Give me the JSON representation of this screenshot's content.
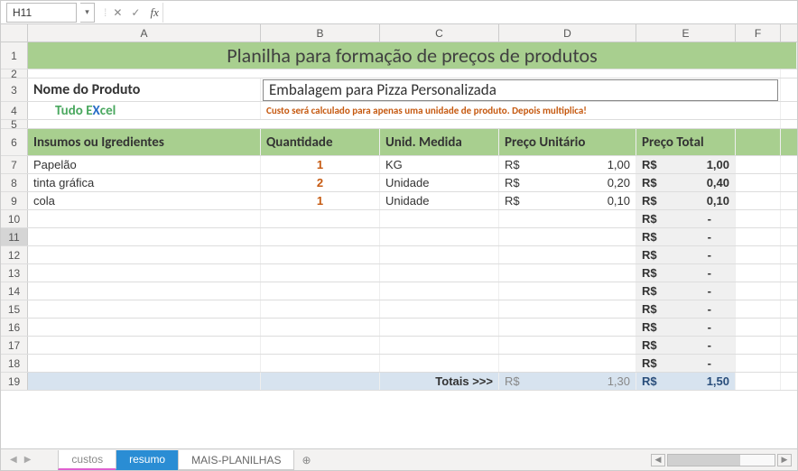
{
  "name_box": "H11",
  "fx_value": "",
  "columns": [
    "A",
    "B",
    "C",
    "D",
    "E",
    "F"
  ],
  "title": "Planilha para formação de preços de produtos",
  "product_label": "Nome do Produto",
  "brand_parts": {
    "tudo": "Tudo E",
    "x": "X",
    "cel": "cel"
  },
  "product_name": "Embalagem para Pizza Personalizada",
  "note": "Custo será calculado para apenas uma unidade de produto. Depois multiplica!",
  "headers": {
    "a": "Insumos ou Igredientes",
    "b": "Quantidade",
    "c": "Unid. Medida",
    "d": "Preço Unitário",
    "e": "Preço Total"
  },
  "rows": [
    {
      "name": "Papelão",
      "qty": "1",
      "unit": "KG",
      "price_cur": "R$",
      "price_val": "1,00",
      "total_cur": "R$",
      "total_val": "1,00"
    },
    {
      "name": "tinta gráfica",
      "qty": "2",
      "unit": "Unidade",
      "price_cur": "R$",
      "price_val": "0,20",
      "total_cur": "R$",
      "total_val": "0,40"
    },
    {
      "name": "cola",
      "qty": "1",
      "unit": "Unidade",
      "price_cur": "R$",
      "price_val": "0,10",
      "total_cur": "R$",
      "total_val": "0,10"
    },
    {
      "name": "",
      "qty": "",
      "unit": "",
      "price_cur": "",
      "price_val": "",
      "total_cur": "R$",
      "total_val": "-"
    },
    {
      "name": "",
      "qty": "",
      "unit": "",
      "price_cur": "",
      "price_val": "",
      "total_cur": "R$",
      "total_val": "-"
    },
    {
      "name": "",
      "qty": "",
      "unit": "",
      "price_cur": "",
      "price_val": "",
      "total_cur": "R$",
      "total_val": "-"
    },
    {
      "name": "",
      "qty": "",
      "unit": "",
      "price_cur": "",
      "price_val": "",
      "total_cur": "R$",
      "total_val": "-"
    },
    {
      "name": "",
      "qty": "",
      "unit": "",
      "price_cur": "",
      "price_val": "",
      "total_cur": "R$",
      "total_val": "-"
    },
    {
      "name": "",
      "qty": "",
      "unit": "",
      "price_cur": "",
      "price_val": "",
      "total_cur": "R$",
      "total_val": "-"
    },
    {
      "name": "",
      "qty": "",
      "unit": "",
      "price_cur": "",
      "price_val": "",
      "total_cur": "R$",
      "total_val": "-"
    },
    {
      "name": "",
      "qty": "",
      "unit": "",
      "price_cur": "",
      "price_val": "",
      "total_cur": "R$",
      "total_val": "-"
    },
    {
      "name": "",
      "qty": "",
      "unit": "",
      "price_cur": "",
      "price_val": "",
      "total_cur": "R$",
      "total_val": "-"
    }
  ],
  "totals": {
    "label": "Totais >>>",
    "d_cur": "R$",
    "d_val": "1,30",
    "e_cur": "R$",
    "e_val": "1,50"
  },
  "sheets": {
    "custos": "custos",
    "resumo": "resumo",
    "mais": "MAIS-PLANILHAS"
  }
}
